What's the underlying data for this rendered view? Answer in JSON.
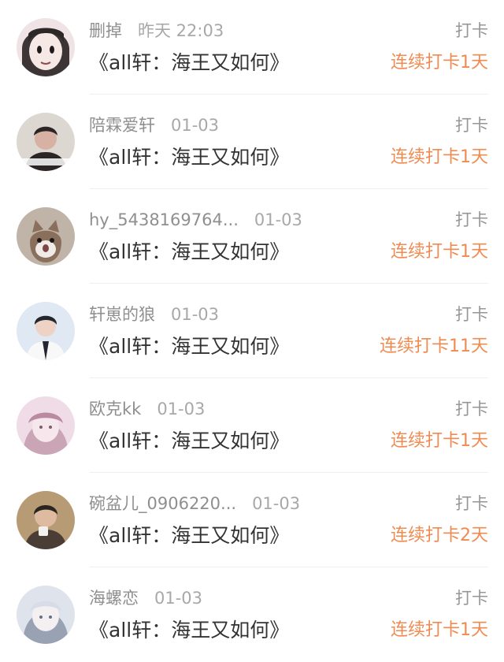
{
  "items": [
    {
      "username": "删掉",
      "date": "昨天 22:03",
      "title": "《all轩：海王又如何》",
      "action": "打卡",
      "streak": "连续打卡1天",
      "avatar": {
        "icon": "anime-girl-avatar",
        "bg": "#efe3e5",
        "tone": "#3d3436"
      }
    },
    {
      "username": "陪霖爱轩",
      "date": "01-03",
      "title": "《all轩：海王又如何》",
      "action": "打卡",
      "streak": "连续打卡1天",
      "avatar": {
        "icon": "young-man-avatar",
        "bg": "#ddd7d2",
        "tone": "#2b2525"
      }
    },
    {
      "username": "hy_5438169764...",
      "date": "01-03",
      "title": "《all轩：海王又如何》",
      "action": "打卡",
      "streak": "连续打卡1天",
      "avatar": {
        "icon": "cat-avatar",
        "bg": "#c0b3a7",
        "tone": "#8a6f5d"
      }
    },
    {
      "username": "轩崽的狼",
      "date": "01-03",
      "title": "《all轩：海王又如何》",
      "action": "打卡",
      "streak": "连续打卡11天",
      "avatar": {
        "icon": "boy-avatar",
        "bg": "#dfe8f3",
        "tone": "#23262f"
      }
    },
    {
      "username": "欧克kk",
      "date": "01-03",
      "title": "《all轩：海王又如何》",
      "action": "打卡",
      "streak": "连续打卡1天",
      "avatar": {
        "icon": "pink-anime-avatar",
        "bg": "#f0dce7",
        "tone": "#c9a5b6"
      }
    },
    {
      "username": "碗盆儿_0906220...",
      "date": "01-03",
      "title": "《all轩：海王又如何》",
      "action": "打卡",
      "streak": "连续打卡2天",
      "avatar": {
        "icon": "man-portrait-avatar",
        "bg": "#b79b74",
        "tone": "#2b2522"
      }
    },
    {
      "username": "海螺恋",
      "date": "01-03",
      "title": "《all轩：海王又如何》",
      "action": "打卡",
      "streak": "连续打卡1天",
      "avatar": {
        "icon": "white-hair-avatar",
        "bg": "#dfe3ec",
        "tone": "#98a2b3"
      }
    }
  ]
}
